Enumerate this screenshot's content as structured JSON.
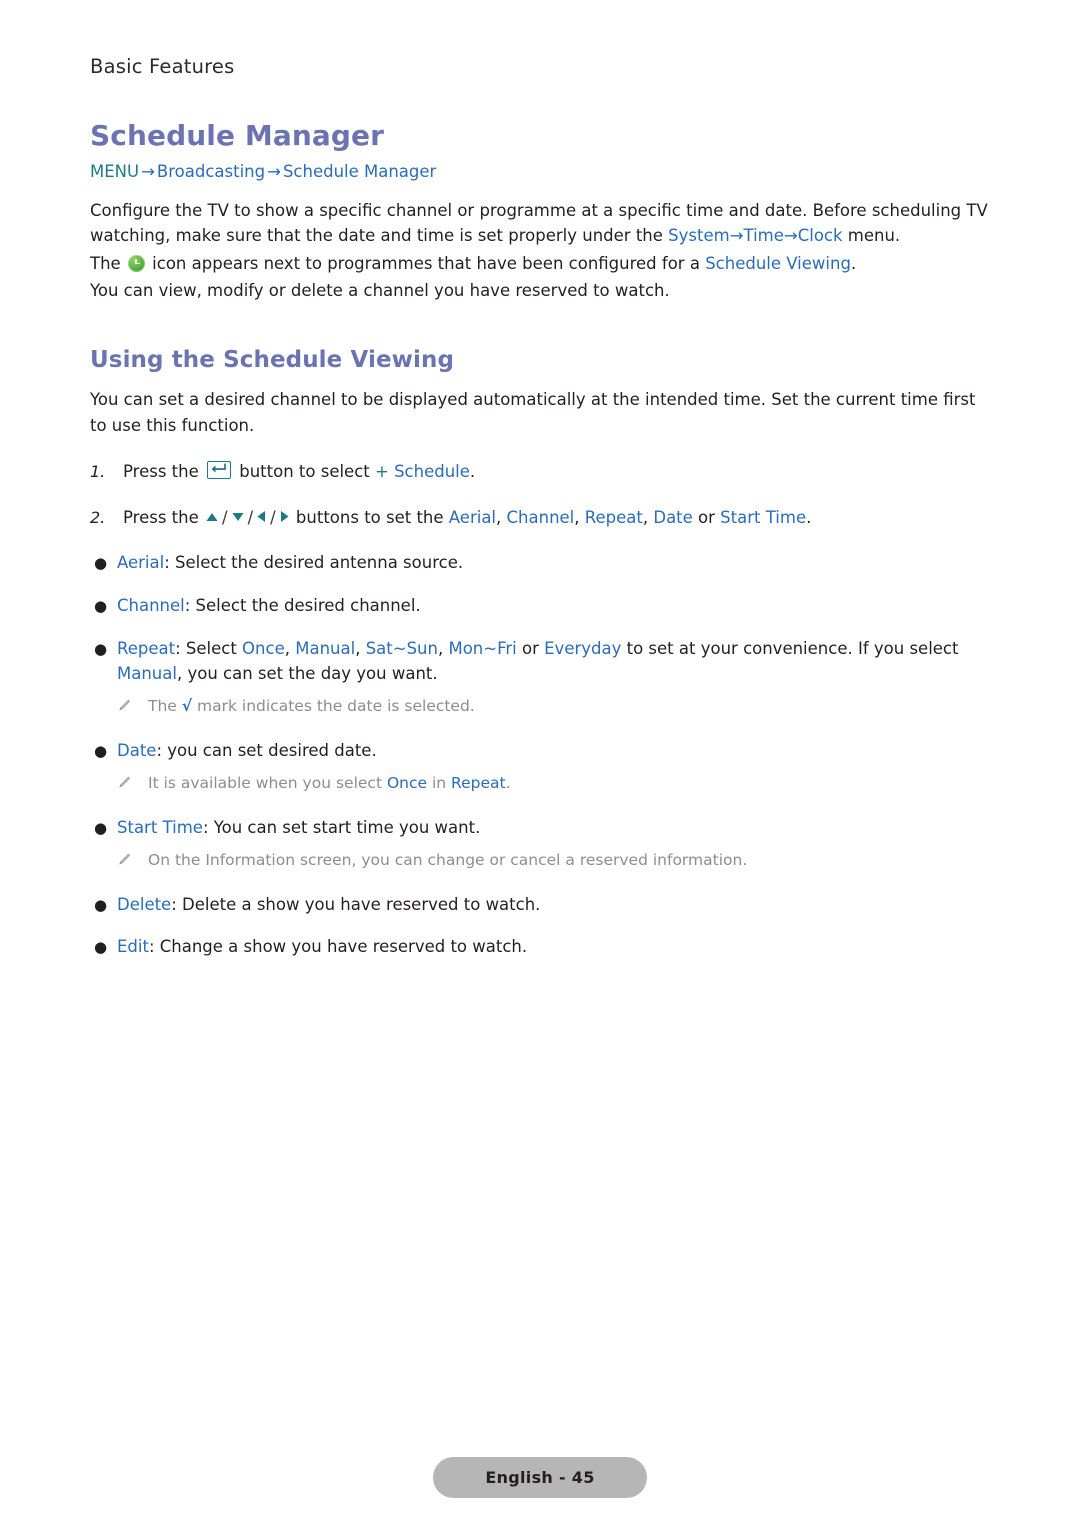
{
  "running_head": "Basic Features",
  "section": {
    "title": "Schedule Manager",
    "menu_path": {
      "menu_label": "MENU",
      "arrow": "→",
      "item1": "Broadcasting",
      "item2": "Schedule Manager"
    },
    "paragraphs": {
      "p1_a": "Configure the TV to show a specific channel or programme at a specific time and date. Before scheduling TV watching, make sure that the date and time is set properly under the ",
      "p1_link1": "System",
      "p1_arrow1": "→",
      "p1_link2": "Time",
      "p1_arrow2": "→",
      "p1_link3": "Clock",
      "p1_b": " menu.",
      "p2_a": "The ",
      "p2_b": " icon appears next to programmes that have been configured for a ",
      "p2_link": "Schedule Viewing",
      "p2_c": ".",
      "p3": "You can view, modify or delete a channel you have reserved to watch."
    }
  },
  "subsection": {
    "title": "Using the Schedule Viewing",
    "intro": "You can set a desired channel to be displayed automatically at the intended time. Set the current time first to use this function.",
    "steps": [
      {
        "num": "1.",
        "pre": "Press the ",
        "icon": "return-key-icon",
        "mid": " button to select ",
        "plus": "+ ",
        "link": "Schedule",
        "post": "."
      },
      {
        "num": "2.",
        "pre": "Press the ",
        "mid": " buttons to set the ",
        "link1": "Aerial",
        "sep1": ", ",
        "link2": "Channel",
        "sep2": ", ",
        "link3": "Repeat",
        "sep3": ", ",
        "link4": "Date",
        "sep4": " or ",
        "link5": "Start Time",
        "post": "."
      }
    ],
    "bullets": [
      {
        "term": "Aerial",
        "desc": ": Select the desired antenna source."
      },
      {
        "term": "Channel",
        "desc": ": Select the desired channel."
      },
      {
        "term": "Repeat",
        "desc_a": ": Select ",
        "opt1": "Once",
        "sep1": ", ",
        "opt2": "Manual",
        "sep2": ", ",
        "opt3": "Sat~Sun",
        "sep3": ", ",
        "opt4": "Mon~Fri",
        "sep4": " or ",
        "opt5": "Everyday",
        "desc_b": " to set at your convenience. If you select ",
        "opt6": "Manual",
        "desc_c": ", you can set the day you want.",
        "note_a": "The ",
        "note_check": "√",
        "note_b": " mark indicates the date is selected."
      },
      {
        "term": "Date",
        "desc": ": you can set desired date.",
        "note_a": "It is available when you select ",
        "note_link1": "Once",
        "note_b": " in ",
        "note_link2": "Repeat",
        "note_c": "."
      },
      {
        "term": "Start Time",
        "desc": ": You can set start time you want.",
        "note_a": "On the Information screen, you can change or cancel a reserved information."
      },
      {
        "term": "Delete",
        "desc": ": Delete a show you have reserved to watch."
      },
      {
        "term": "Edit",
        "desc": ": Change a show you have reserved to watch."
      }
    ]
  },
  "footer": {
    "page_label": "English - 45"
  },
  "colors": {
    "heading": "#6b73b3",
    "link": "#2b6cb8",
    "teal": "#1c7a86",
    "body": "#231f20",
    "note": "#8d8d8d",
    "pill_bg": "#b6b6b6"
  }
}
